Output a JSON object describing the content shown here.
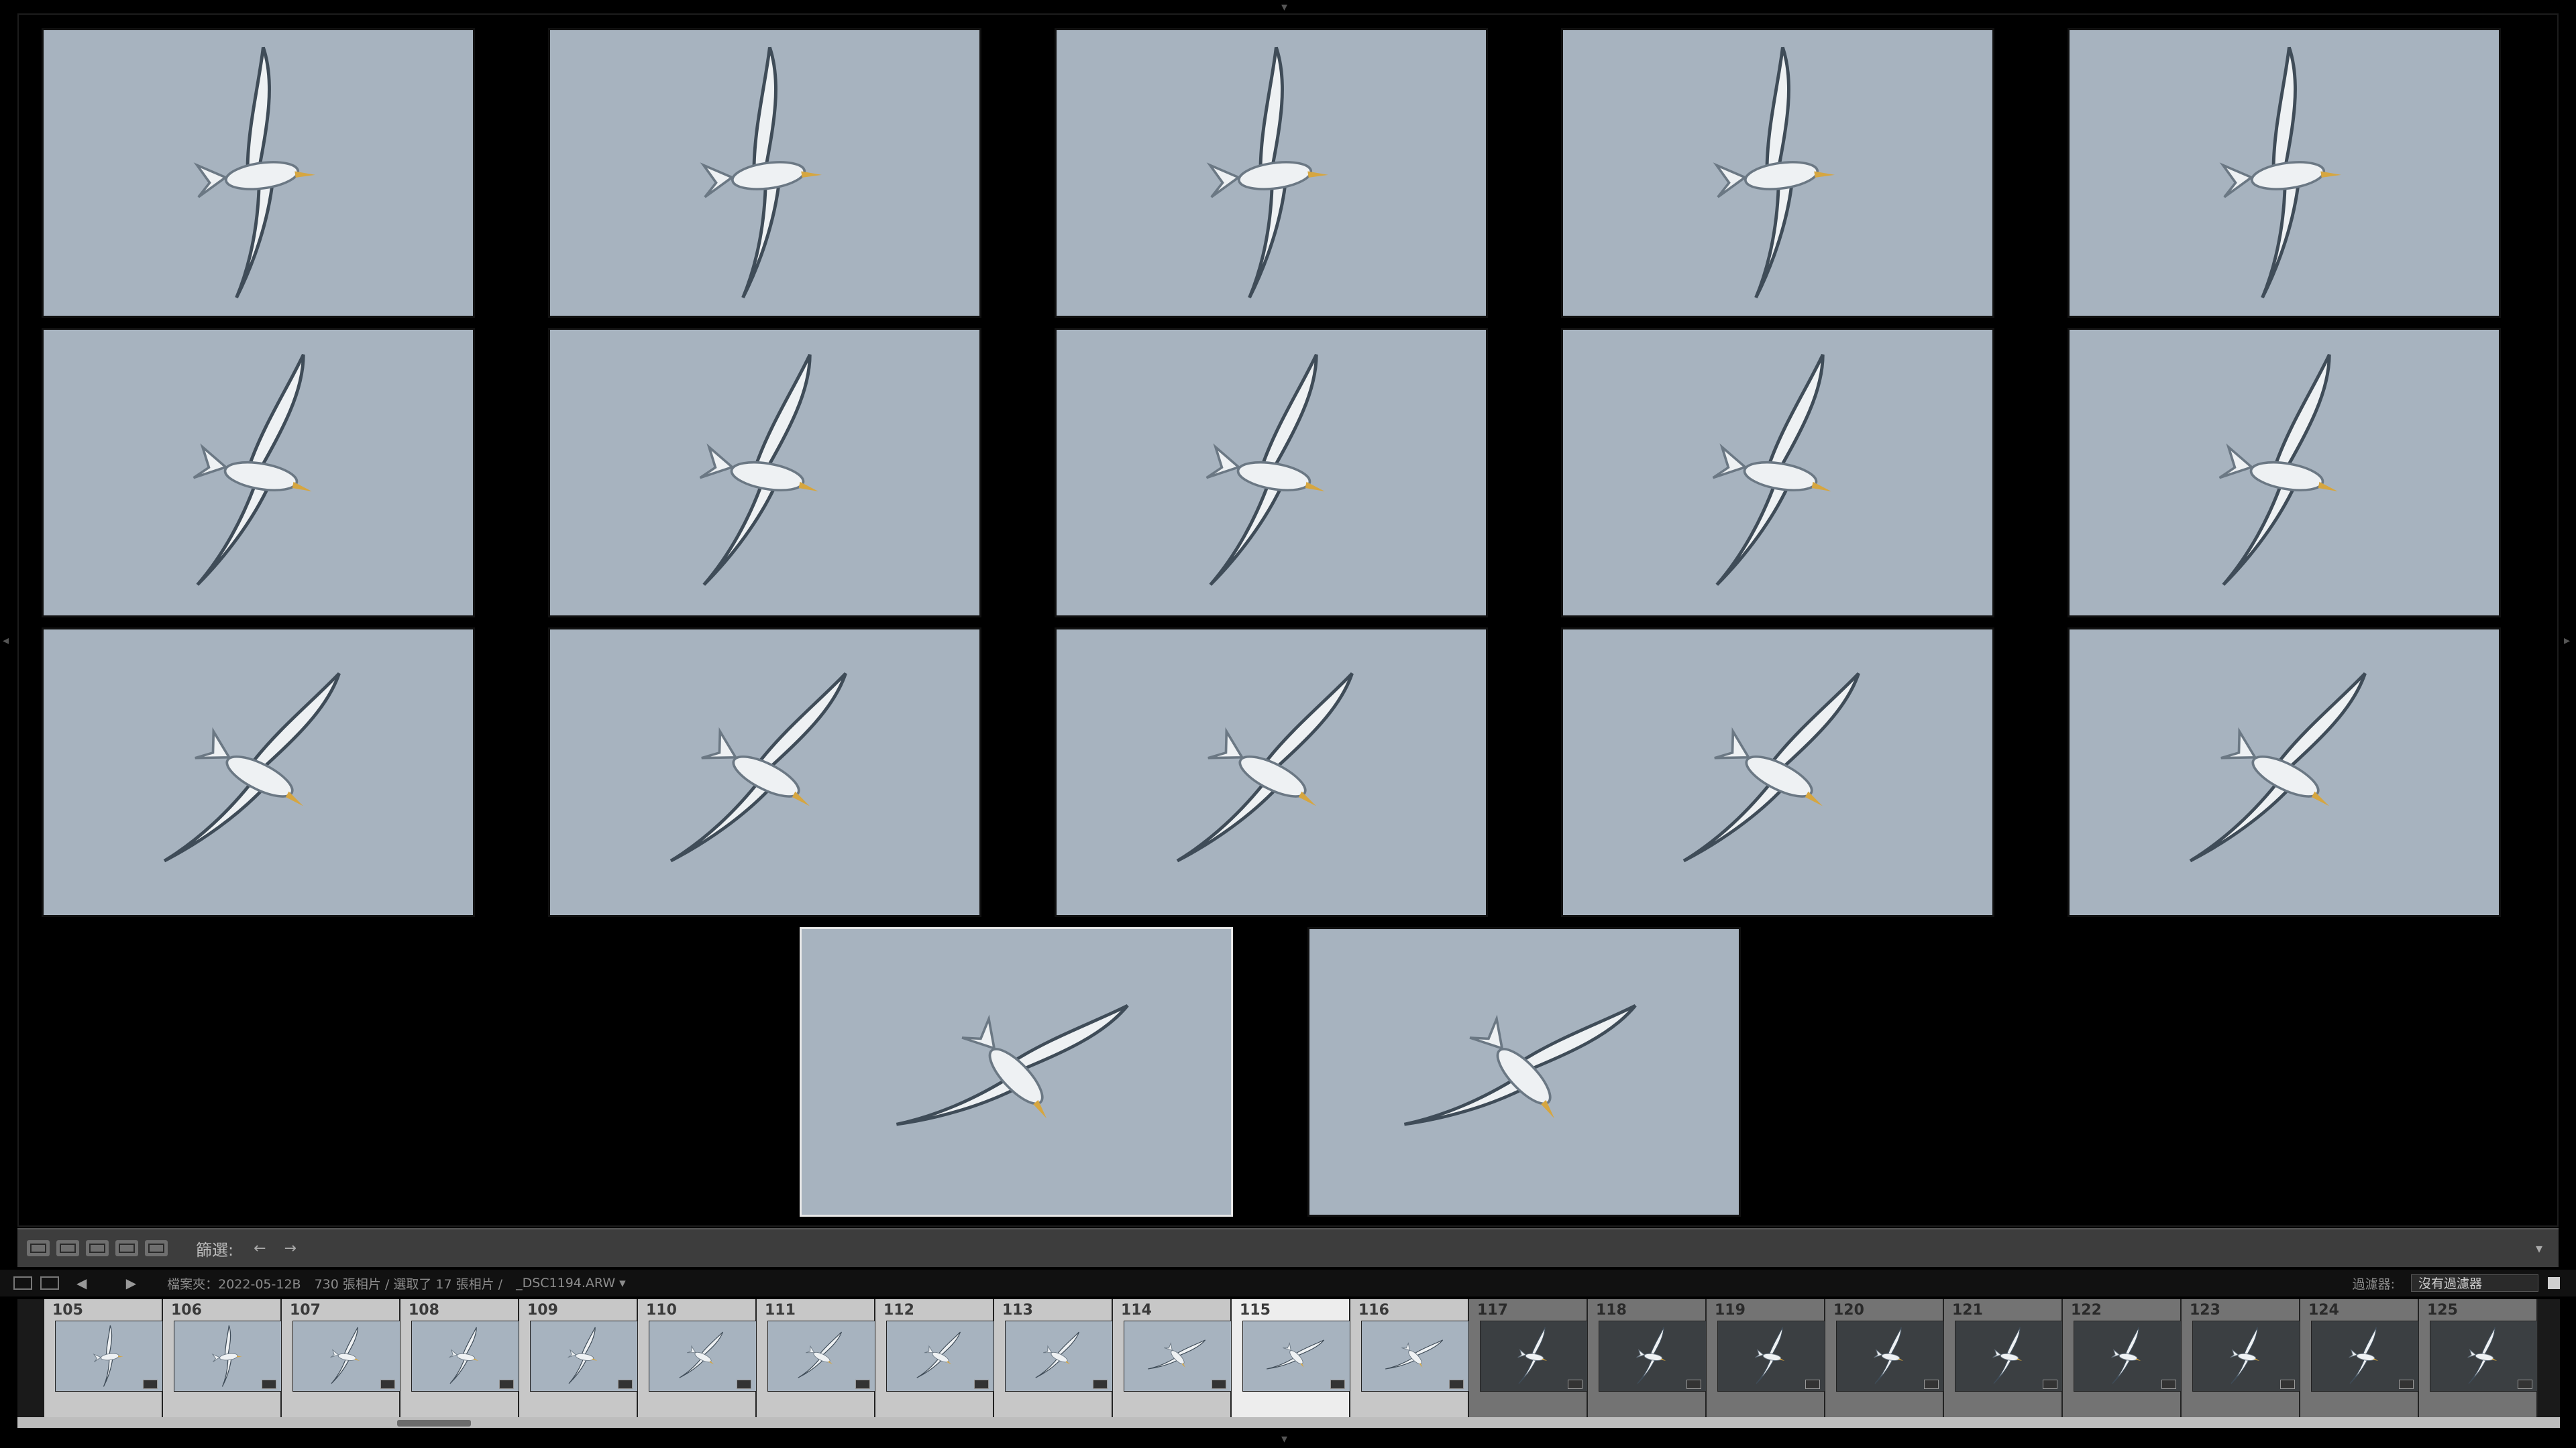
{
  "survey": {
    "thumbnails": [
      {
        "pose": 1
      },
      {
        "pose": 1
      },
      {
        "pose": 1
      },
      {
        "pose": 1
      },
      {
        "pose": 1
      },
      {
        "pose": 2
      },
      {
        "pose": 2
      },
      {
        "pose": 2
      },
      {
        "pose": 2
      },
      {
        "pose": 2
      },
      {
        "pose": 3
      },
      {
        "pose": 3
      },
      {
        "pose": 3
      },
      {
        "pose": 3
      },
      {
        "pose": 3
      },
      {
        "pose": 4,
        "active": true
      },
      {
        "pose": 4
      }
    ]
  },
  "toolbar": {
    "view_icons": [
      "grid-view-icon",
      "loupe-view-icon",
      "compare-view-icon",
      "survey-view-icon",
      "people-view-icon"
    ],
    "sort_label": "篩選:",
    "arrows": "← →",
    "menu_arrow": "▾"
  },
  "filmstrip_header": {
    "folder": "檔案夾：2022-05-12B",
    "count": "730 張相片 / 選取了 17 張相片 /",
    "file": "_DSC1194.ARW",
    "file_suffix": "▾",
    "filter_label": "過濾器:",
    "filter_value": "沒有過濾器",
    "nav_arrows": "◀ ▶"
  },
  "filmstrip": {
    "cells": [
      {
        "num": "105",
        "kind": "light"
      },
      {
        "num": "106",
        "kind": "light"
      },
      {
        "num": "107",
        "kind": "light"
      },
      {
        "num": "108",
        "kind": "light"
      },
      {
        "num": "109",
        "kind": "light"
      },
      {
        "num": "110",
        "kind": "light"
      },
      {
        "num": "111",
        "kind": "light"
      },
      {
        "num": "112",
        "kind": "light"
      },
      {
        "num": "113",
        "kind": "light"
      },
      {
        "num": "114",
        "kind": "light"
      },
      {
        "num": "115",
        "kind": "sel"
      },
      {
        "num": "116",
        "kind": "light"
      },
      {
        "num": "117",
        "kind": "dark"
      },
      {
        "num": "118",
        "kind": "dark"
      },
      {
        "num": "119",
        "kind": "dark"
      },
      {
        "num": "120",
        "kind": "dark"
      },
      {
        "num": "121",
        "kind": "dark"
      },
      {
        "num": "122",
        "kind": "dark"
      },
      {
        "num": "123",
        "kind": "dark"
      },
      {
        "num": "124",
        "kind": "dark"
      },
      {
        "num": "125",
        "kind": "dark"
      }
    ]
  },
  "colors": {
    "sky": "#a7b3bf",
    "bird": "#eef1f3",
    "wing_tip": "#3f4c58",
    "beak": "#d6a640"
  }
}
